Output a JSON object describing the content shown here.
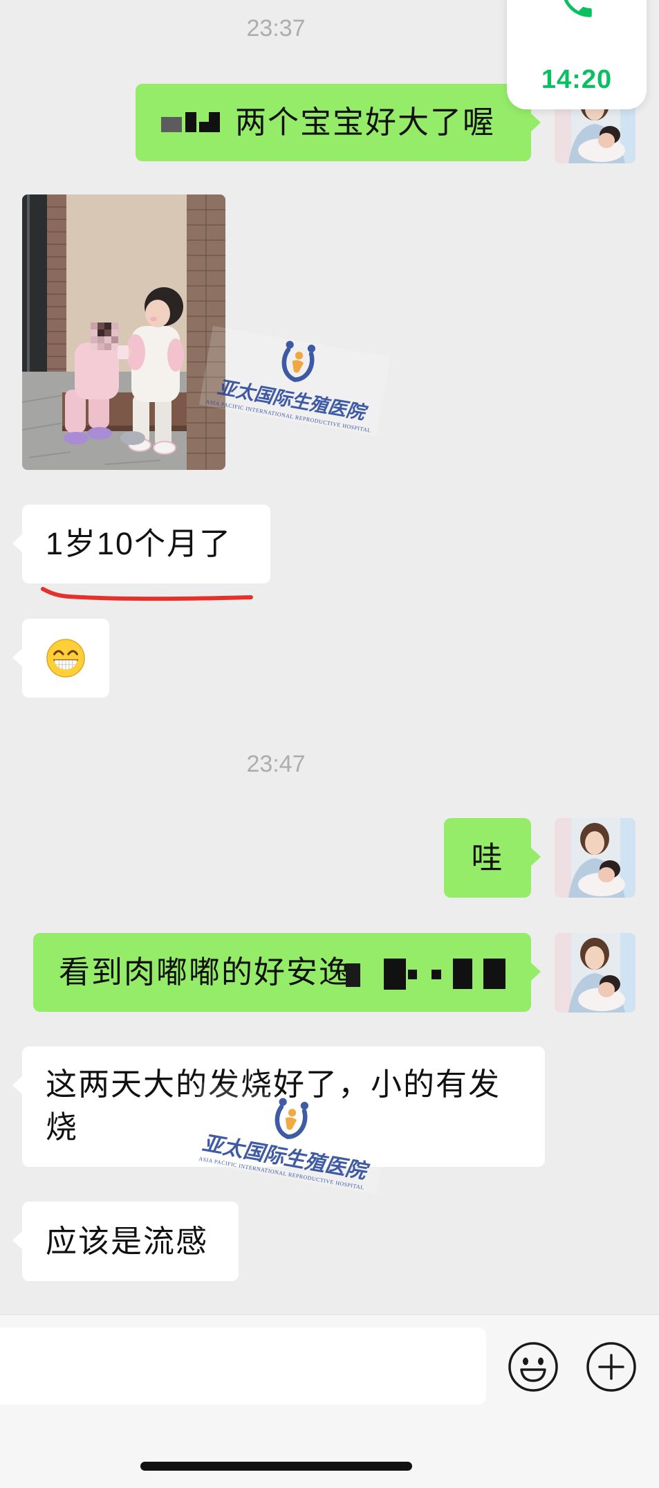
{
  "call_widget": {
    "duration": "14:20",
    "icon": "phone-icon"
  },
  "chat": {
    "timestamps": [
      "23:37",
      "23:47"
    ],
    "messages": [
      {
        "outgoing": true,
        "text": "两个宝宝好大了喔",
        "redacted": true
      },
      {
        "outgoing": false,
        "image": true
      },
      {
        "outgoing": false,
        "text": "1岁10个月了",
        "underlined": true
      },
      {
        "outgoing": false,
        "emoji_icon": "grinning-face-icon"
      },
      {
        "outgoing": true,
        "text": "哇"
      },
      {
        "outgoing": true,
        "text": "看到肉嘟嘟的好安逸",
        "redacted": true
      },
      {
        "outgoing": false,
        "text": "这两天大的发烧好了，小的有发烧"
      },
      {
        "outgoing": false,
        "text": "应该是流感"
      }
    ]
  },
  "watermark": {
    "name_zh": "亚太国际生殖医院",
    "name_en": "ASIA PACIFIC INTERNATIONAL REPRODUCTIVE HOSPITAL"
  },
  "input_bar": {
    "value": "",
    "emoji_button_icon": "smile-icon",
    "more_button_icon": "plus-circle-icon"
  },
  "colors": {
    "background": "#ededed",
    "outgoing_bubble": "#95ec69",
    "incoming_bubble": "#ffffff",
    "call_accent": "#07c160",
    "underline_annotation": "#e8302a",
    "watermark": "#2b4a9b"
  }
}
